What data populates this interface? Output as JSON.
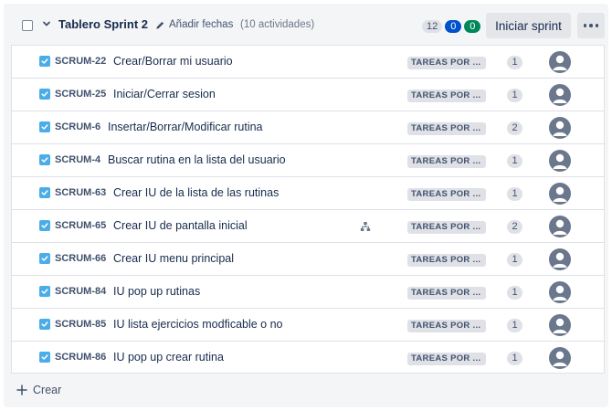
{
  "sprint": {
    "title": "Tablero Sprint 2",
    "add_dates_label": "Añadir fechas",
    "activity_count": "(10 actividades)",
    "counts": {
      "todo": "12",
      "in_progress": "0",
      "done": "0"
    },
    "start_button_label": "Iniciar sprint",
    "more_icon": "more-horizontal-icon"
  },
  "issues": [
    {
      "key": "SCRUM-22",
      "summary": "Crear/Borrar mi usuario",
      "status": "TAREAS POR ...",
      "points": "1",
      "has_child_issues": false
    },
    {
      "key": "SCRUM-25",
      "summary": "Iniciar/Cerrar sesion",
      "status": "TAREAS POR ...",
      "points": "1",
      "has_child_issues": false
    },
    {
      "key": "SCRUM-6",
      "summary": "Insertar/Borrar/Modificar rutina",
      "status": "TAREAS POR ...",
      "points": "2",
      "has_child_issues": false
    },
    {
      "key": "SCRUM-4",
      "summary": "Buscar rutina en la lista del usuario",
      "status": "TAREAS POR ...",
      "points": "1",
      "has_child_issues": false
    },
    {
      "key": "SCRUM-63",
      "summary": "Crear IU de la lista de las rutinas",
      "status": "TAREAS POR ...",
      "points": "1",
      "has_child_issues": false
    },
    {
      "key": "SCRUM-65",
      "summary": "Crear IU de pantalla inicial",
      "status": "TAREAS POR ...",
      "points": "2",
      "has_child_issues": true
    },
    {
      "key": "SCRUM-66",
      "summary": "Crear IU menu principal",
      "status": "TAREAS POR ...",
      "points": "1",
      "has_child_issues": false
    },
    {
      "key": "SCRUM-84",
      "summary": "IU pop up rutinas",
      "status": "TAREAS POR ...",
      "points": "1",
      "has_child_issues": false
    },
    {
      "key": "SCRUM-85",
      "summary": "IU lista ejercicios modficable o no",
      "status": "TAREAS POR ...",
      "points": "1",
      "has_child_issues": false
    },
    {
      "key": "SCRUM-86",
      "summary": "IU pop up crear rutina",
      "status": "TAREAS POR ...",
      "points": "1",
      "has_child_issues": false
    }
  ],
  "footer": {
    "create_label": "Crear"
  },
  "colors": {
    "task_type": "#4bade8",
    "in_progress_badge": "#0052cc",
    "done_badge": "#00875a",
    "avatar": "#6b778c"
  }
}
